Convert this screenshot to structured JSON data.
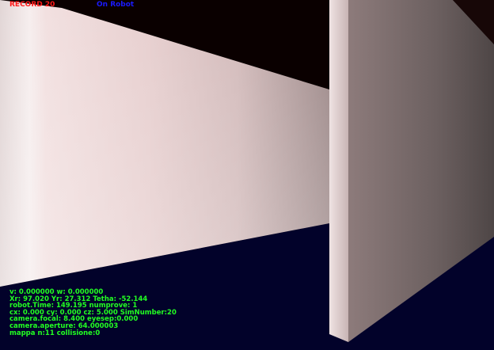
{
  "colors": {
    "record": "#ff1a1a",
    "mode": "#1a1aff",
    "telemetry": "#22ff22",
    "ceiling": "#0a0000",
    "floor": "#02022a"
  },
  "status": {
    "record_label": "RECORD 20",
    "mode_label": "On Robot"
  },
  "telemetry": {
    "lines": [
      "v: 0.000000 w: 0.000000",
      "Xr: 97.020 Yr: 27.312 Tetha: -52.144",
      "robot.Time: 149.195 numprove: 1",
      "cx: 0.000 cy: 0.000 cz: 5.000 SimNumber:20",
      "camera.focal: 8.400 eyesep:0.000",
      "camera.aperture: 64.000003",
      "mappa n:11 collisione:0"
    ]
  }
}
